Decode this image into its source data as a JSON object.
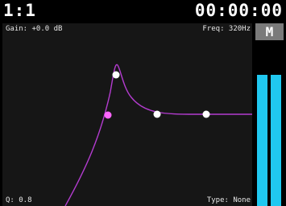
{
  "header": {
    "track": "1:1",
    "time": "00:00:00"
  },
  "eq": {
    "gain_label": "Gain: +0.0 dB",
    "freq_label": "Freq: 320Hz",
    "q_label": "Q: 0.8",
    "type_label": "Type: None",
    "curve_color": "#b43cd0",
    "selected_point_color": "#ff66ff",
    "point_color": "#ffffff",
    "background_color": "#161616"
  },
  "meter": {
    "label": "M",
    "left_level": 0.8,
    "right_level": 0.8,
    "bar_color": "#20c8f0",
    "header_color": "#7a7a7a"
  }
}
